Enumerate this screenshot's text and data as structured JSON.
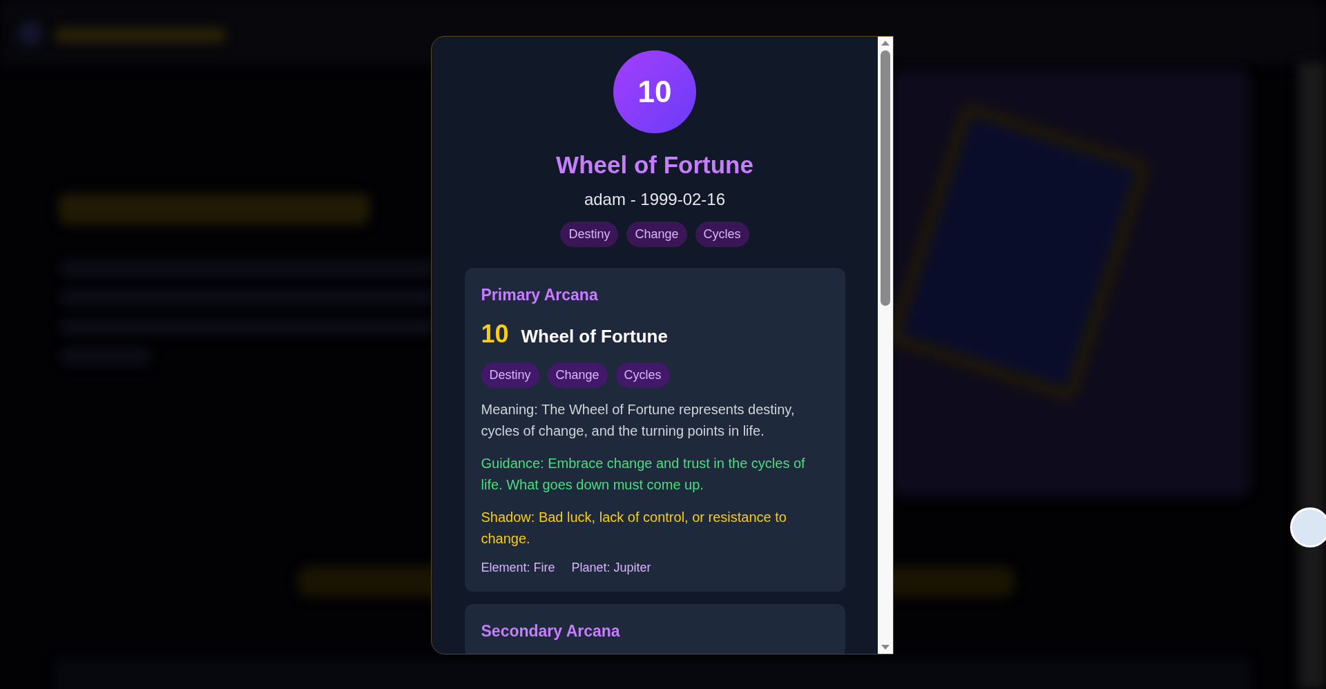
{
  "modal": {
    "badge": "10",
    "title": "Wheel of Fortune",
    "subtitle": "adam - 1999-02-16",
    "tags": [
      "Destiny",
      "Change",
      "Cycles"
    ],
    "sections": [
      {
        "heading": "Primary Arcana",
        "number": "10",
        "name": "Wheel of Fortune",
        "tags": [
          "Destiny",
          "Change",
          "Cycles"
        ],
        "meaning": "Meaning: The Wheel of Fortune represents destiny, cycles of change, and the turning points in life.",
        "guidance": "Guidance: Embrace change and trust in the cycles of life. What goes down must come up.",
        "shadow": "Shadow: Bad luck, lack of control, or resistance to change.",
        "attributes": [
          "Element: Fire",
          "Planet: Jupiter"
        ]
      },
      {
        "heading": "Secondary Arcana"
      }
    ]
  }
}
